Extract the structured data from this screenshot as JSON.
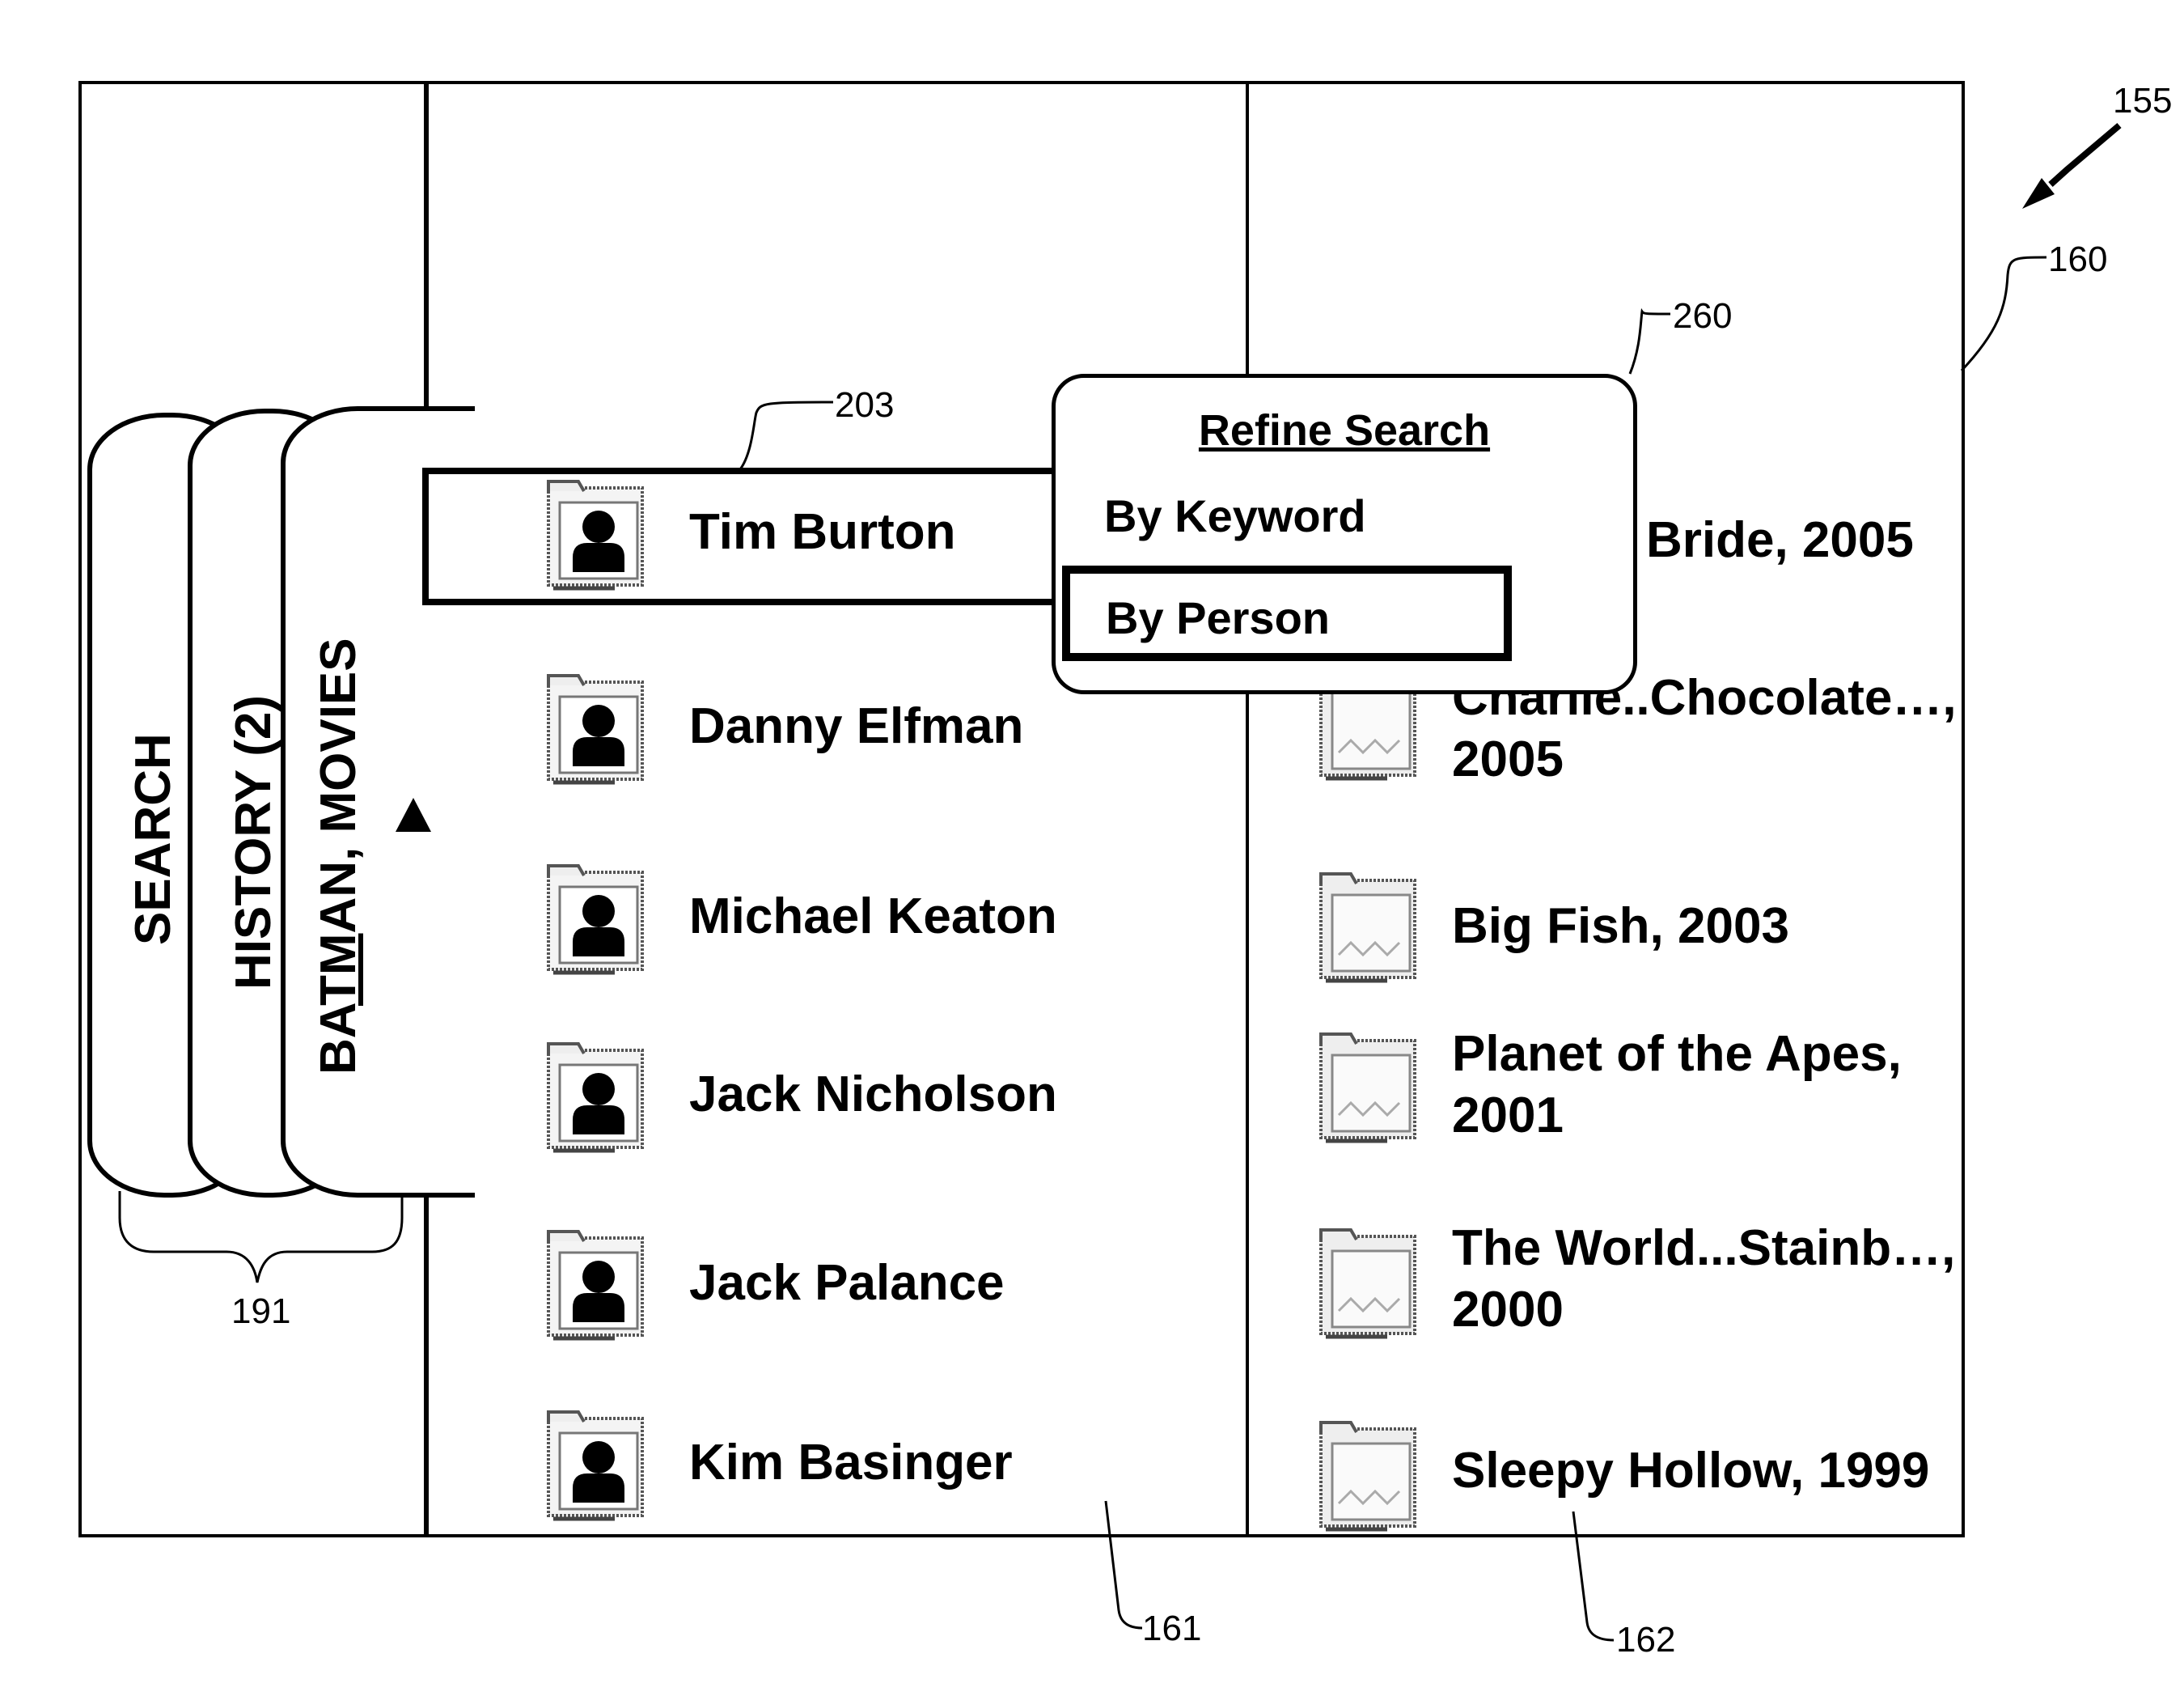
{
  "figure_ref": "155",
  "refs": {
    "display": "160",
    "middle_column": "161",
    "right_column": "162",
    "selected_row": "203",
    "popup": "260",
    "tabs": "191"
  },
  "tabs": [
    {
      "label": "SEARCH"
    },
    {
      "label": "HISTORY (2)"
    },
    {
      "label": "BATMAN, MOVIES",
      "underlined_part": "TM",
      "active": true
    }
  ],
  "people": [
    {
      "name": "Tim Burton",
      "icon": "person-folder-icon",
      "selected": true
    },
    {
      "name": "Danny Elfman",
      "icon": "person-folder-icon"
    },
    {
      "name": "Michael Keaton",
      "icon": "person-folder-icon"
    },
    {
      "name": "Jack Nicholson",
      "icon": "person-folder-icon"
    },
    {
      "name": "Jack Palance",
      "icon": "person-folder-icon"
    },
    {
      "name": "Kim Basinger",
      "icon": "person-folder-icon"
    }
  ],
  "movies": [
    {
      "line1": "Bride, 2005",
      "line2": "",
      "icon": "movie-folder-icon",
      "obscured": true
    },
    {
      "line1": "Charlie..Chocolate…,",
      "line2": "2005",
      "icon": "movie-folder-icon",
      "obscured": true
    },
    {
      "line1": "Big Fish, 2003",
      "line2": "",
      "icon": "movie-folder-icon"
    },
    {
      "line1": "Planet of the Apes,",
      "line2": "2001",
      "icon": "movie-folder-icon"
    },
    {
      "line1": "The World...Stainb…,",
      "line2": "2000",
      "icon": "movie-folder-icon"
    },
    {
      "line1": "Sleepy Hollow, 1999",
      "line2": "",
      "icon": "movie-folder-icon"
    }
  ],
  "popup": {
    "title": "Refine Search",
    "options": [
      {
        "label": "By Keyword"
      },
      {
        "label": "By Person",
        "selected": true
      }
    ]
  }
}
